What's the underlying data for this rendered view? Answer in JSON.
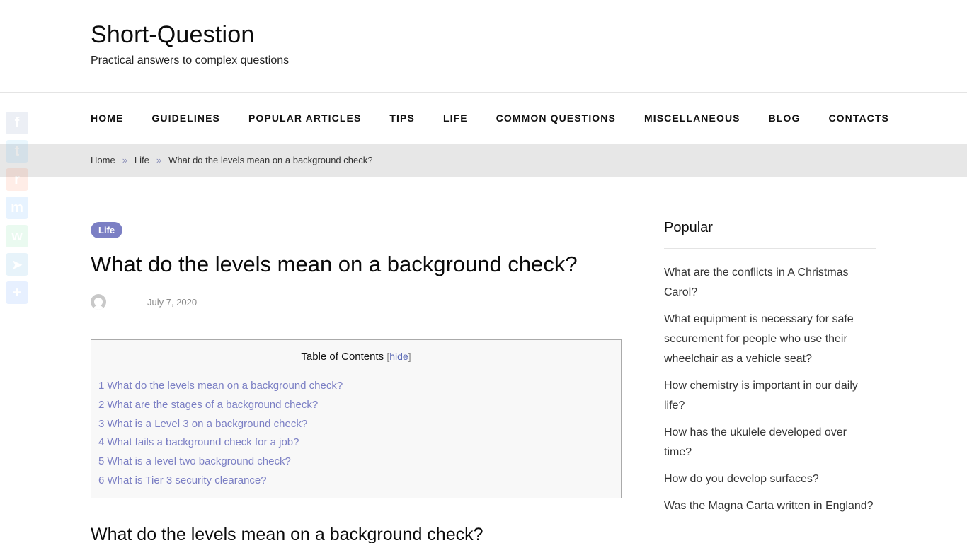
{
  "site": {
    "title": "Short-Question",
    "tagline": "Practical answers to complex questions"
  },
  "nav": {
    "items": [
      {
        "label": "HOME"
      },
      {
        "label": "GUIDELINES"
      },
      {
        "label": "POPULAR ARTICLES"
      },
      {
        "label": "TIPS"
      },
      {
        "label": "LIFE"
      },
      {
        "label": "COMMON QUESTIONS"
      },
      {
        "label": "MISCELLANEOUS"
      },
      {
        "label": "BLOG"
      },
      {
        "label": "CONTACTS"
      }
    ]
  },
  "breadcrumb": {
    "separator": "»",
    "items": [
      {
        "label": "Home"
      },
      {
        "label": "Life"
      },
      {
        "label": "What do the levels mean on a background check?"
      }
    ]
  },
  "share": {
    "buttons": [
      {
        "icon": "facebook-icon",
        "glyph": "f",
        "color": "#3b5998"
      },
      {
        "icon": "twitter-icon",
        "glyph": "t",
        "color": "#1da1f2"
      },
      {
        "icon": "reddit-icon",
        "glyph": "r",
        "color": "#ff4500"
      },
      {
        "icon": "messenger-icon",
        "glyph": "m",
        "color": "#0084ff"
      },
      {
        "icon": "whatsapp-icon",
        "glyph": "w",
        "color": "#25d366"
      },
      {
        "icon": "telegram-icon",
        "glyph": "➤",
        "color": "#0088cc"
      },
      {
        "icon": "share-plus-icon",
        "glyph": "+",
        "color": "#0166ff"
      }
    ]
  },
  "article": {
    "category": "Life",
    "title": "What do the levels mean on a background check?",
    "meta_dash": "—",
    "date": "July 7, 2020",
    "section_heading": "What do the levels mean on a background check?"
  },
  "toc": {
    "title": "Table of Contents",
    "toggle_open": "[",
    "toggle_label": "hide",
    "toggle_close": "]",
    "items": [
      {
        "label": "1 What do the levels mean on a background check?"
      },
      {
        "label": "2 What are the stages of a background check?"
      },
      {
        "label": "3 What is a Level 3 on a background check?"
      },
      {
        "label": "4 What fails a background check for a job?"
      },
      {
        "label": "5 What is a level two background check?"
      },
      {
        "label": "6 What is Tier 3 security clearance?"
      }
    ]
  },
  "sidebar": {
    "widget_title": "Popular",
    "items": [
      {
        "label": "What are the conflicts in A Christmas Carol?"
      },
      {
        "label": "What equipment is necessary for safe securement for people who use their wheelchair as a vehicle seat?"
      },
      {
        "label": "How chemistry is important in our daily life?"
      },
      {
        "label": "How has the ukulele developed over time?"
      },
      {
        "label": "How do you develop surfaces?"
      },
      {
        "label": "Was the Magna Carta written in England?"
      }
    ]
  },
  "colors": {
    "accent": "#7b7fc4",
    "breadcrumb_bg": "#e7e7e7",
    "toc_bg": "#f8f8f8"
  }
}
